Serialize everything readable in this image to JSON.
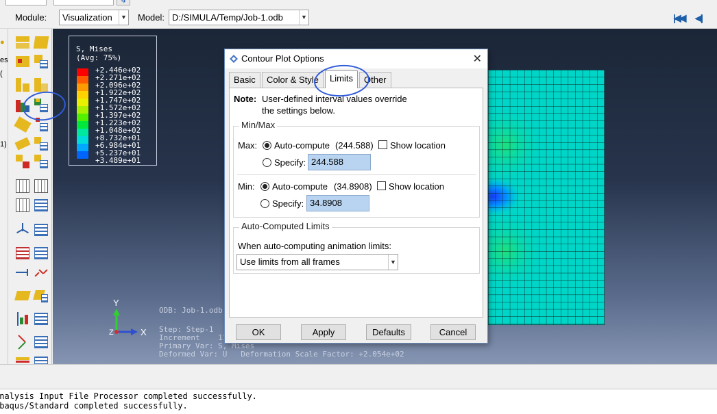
{
  "context_bar": {
    "module_label": "Module:",
    "module_value": "Visualization",
    "model_label": "Model:",
    "model_value": "D:/SIMULA/Temp/Job-1.odb"
  },
  "left_fragments": [
    "es",
    "(",
    "1)"
  ],
  "legend": {
    "title": "S, Mises",
    "subtitle": "(Avg: 75%)",
    "values": [
      "+2.446e+02",
      "+2.271e+02",
      "+2.096e+02",
      "+1.922e+02",
      "+1.747e+02",
      "+1.572e+02",
      "+1.397e+02",
      "+1.223e+02",
      "+1.048e+02",
      "+8.732e+01",
      "+6.984e+01",
      "+5.237e+01",
      "+3.489e+01"
    ],
    "colors": [
      "#ff0000",
      "#ff5a00",
      "#ff9a00",
      "#ffd200",
      "#e8f000",
      "#a8f000",
      "#52f000",
      "#00e83c",
      "#00e8a0",
      "#00dcdc",
      "#00a8ff",
      "#0064ff",
      "#0000ff"
    ]
  },
  "viewport_info": {
    "odb": "ODB: Job-1.odb",
    "step": "Step: Step-1",
    "increment": "Increment    11",
    "primary_var": "Primary Var: S, Mises",
    "deformed_var": "Deformed Var: U   Deformation Scale Factor: +2.054e+02",
    "triad_y": "Y",
    "triad_z": "Z",
    "triad_x": "X"
  },
  "dialog": {
    "title": "Contour Plot Options",
    "tabs": [
      "Basic",
      "Color & Style",
      "Limits",
      "Other"
    ],
    "active_tab": "Limits",
    "note_label": "Note:",
    "note_line1": "User-defined interval values override",
    "note_line2": "the settings below.",
    "minmax_title": "Min/Max",
    "max_label": "Max:",
    "max_auto_label": "Auto-compute",
    "max_auto_value": "(244.588)",
    "max_show_location": "Show location",
    "max_specify_label": "Specify:",
    "max_specify_value": "244.588",
    "min_label": "Min:",
    "min_auto_label": "Auto-compute",
    "min_auto_value": "(34.8908)",
    "min_show_location": "Show location",
    "min_specify_label": "Specify:",
    "min_specify_value": "34.8908",
    "auto_limits_title": "Auto-Computed Limits",
    "animation_label": "When auto-computing animation limits:",
    "animation_value": "Use limits from all frames",
    "ok": "OK",
    "apply": "Apply",
    "defaults": "Defaults",
    "cancel": "Cancel"
  },
  "messages": [
    "Analysis Input File Processor completed successfully.",
    "Abaqus/Standard completed successfully."
  ]
}
